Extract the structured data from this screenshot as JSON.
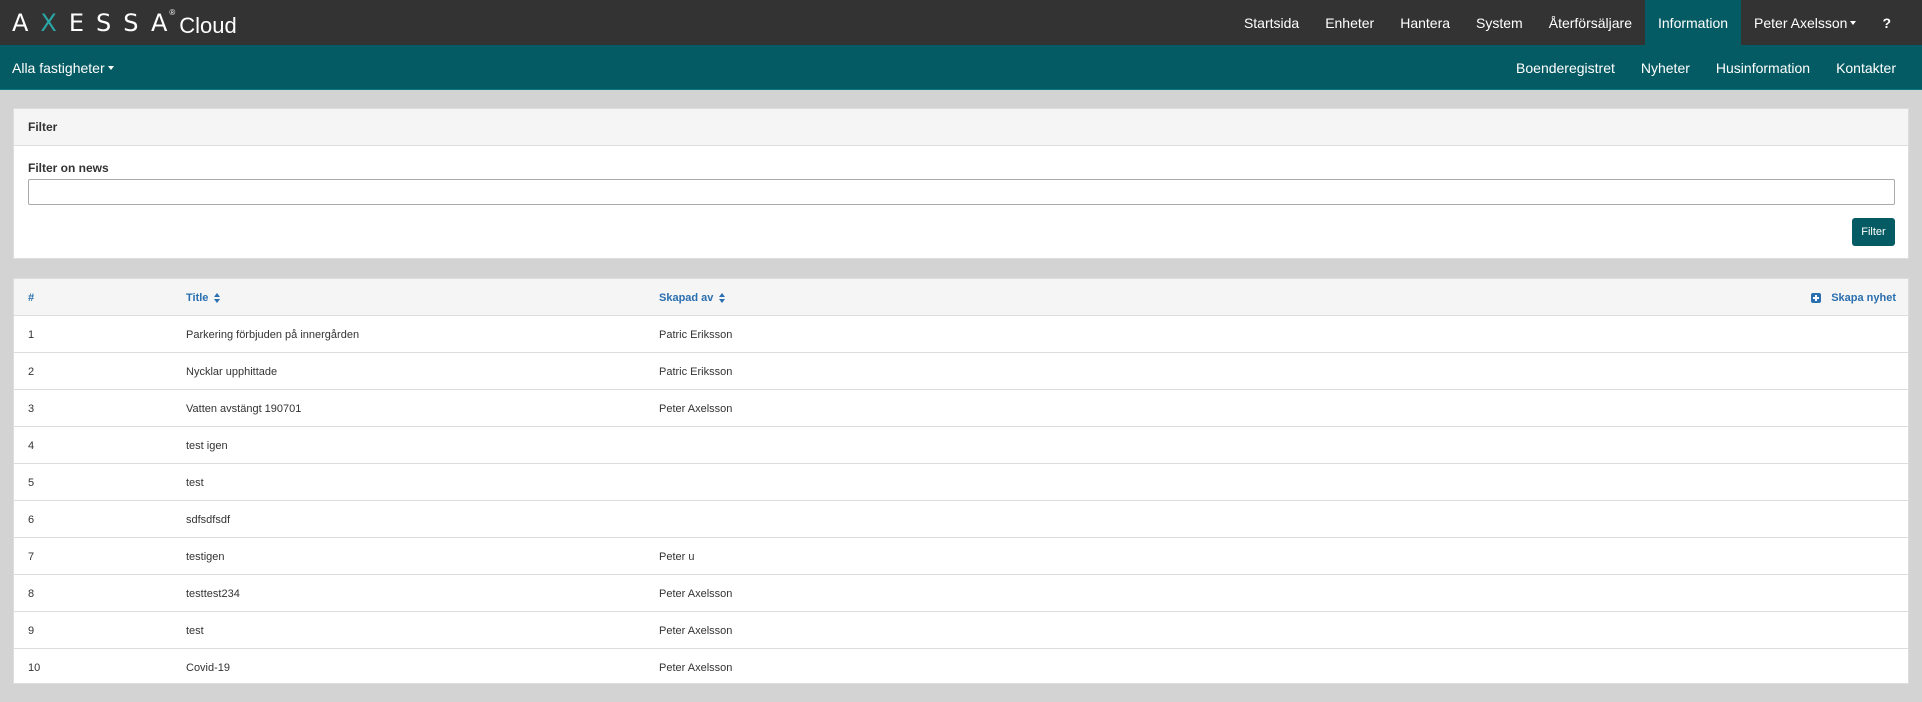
{
  "brand": {
    "letters_pre": "A",
    "letters_x": "X",
    "letters_post": "ESSA",
    "registered": "®",
    "cloud": "Cloud",
    "accent_color": "#2aa6a6"
  },
  "topnav": {
    "items": [
      {
        "label": "Startsida"
      },
      {
        "label": "Enheter"
      },
      {
        "label": "Hantera"
      },
      {
        "label": "System"
      },
      {
        "label": "Återförsäljare"
      },
      {
        "label": "Information",
        "active": true
      },
      {
        "label": "Peter Axelsson"
      },
      {
        "label": "?"
      }
    ]
  },
  "subnav": {
    "property_selector": "Alla fastigheter",
    "items": [
      {
        "label": "Boenderegistret"
      },
      {
        "label": "Nyheter"
      },
      {
        "label": "Husinformation"
      },
      {
        "label": "Kontakter"
      }
    ]
  },
  "filter": {
    "heading": "Filter",
    "label": "Filter on news",
    "value": "",
    "placeholder": "",
    "button": "Filter"
  },
  "table": {
    "headers": {
      "num": "#",
      "title": "Title",
      "created_by": "Skapad av"
    },
    "create_label": "Skapa nyhet",
    "rows": [
      {
        "num": "1",
        "title": "Parkering förbjuden på innergården",
        "created_by": "Patric Eriksson"
      },
      {
        "num": "2",
        "title": "Nycklar upphittade",
        "created_by": "Patric Eriksson"
      },
      {
        "num": "3",
        "title": "Vatten avstängt 190701",
        "created_by": "Peter Axelsson"
      },
      {
        "num": "4",
        "title": "test igen",
        "created_by": ""
      },
      {
        "num": "5",
        "title": "test",
        "created_by": ""
      },
      {
        "num": "6",
        "title": "sdfsdfsdf",
        "created_by": ""
      },
      {
        "num": "7",
        "title": "testigen",
        "created_by": "Peter u"
      },
      {
        "num": "8",
        "title": "testtest234",
        "created_by": "Peter Axelsson"
      },
      {
        "num": "9",
        "title": "test",
        "created_by": "Peter Axelsson"
      },
      {
        "num": "10",
        "title": "Covid-19",
        "created_by": "Peter Axelsson"
      }
    ]
  },
  "colors": {
    "topbar": "#333333",
    "subbar": "#055b63",
    "link": "#2a6fb0",
    "background": "#d3d3d3"
  }
}
